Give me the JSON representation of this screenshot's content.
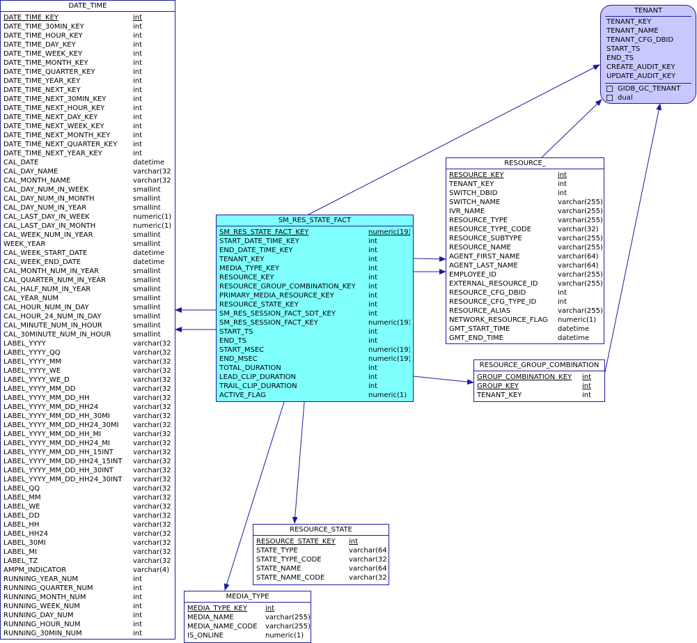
{
  "date_time": {
    "title": "DATE_TIME",
    "columns": [
      [
        "DATE_TIME_KEY",
        "int",
        true
      ],
      [
        "DATE_TIME_30MIN_KEY",
        "int"
      ],
      [
        "DATE_TIME_HOUR_KEY",
        "int"
      ],
      [
        "DATE_TIME_DAY_KEY",
        "int"
      ],
      [
        "DATE_TIME_WEEK_KEY",
        "int"
      ],
      [
        "DATE_TIME_MONTH_KEY",
        "int"
      ],
      [
        "DATE_TIME_QUARTER_KEY",
        "int"
      ],
      [
        "DATE_TIME_YEAR_KEY",
        "int"
      ],
      [
        "DATE_TIME_NEXT_KEY",
        "int"
      ],
      [
        "DATE_TIME_NEXT_30MIN_KEY",
        "int"
      ],
      [
        "DATE_TIME_NEXT_HOUR_KEY",
        "int"
      ],
      [
        "DATE_TIME_NEXT_DAY_KEY",
        "int"
      ],
      [
        "DATE_TIME_NEXT_WEEK_KEY",
        "int"
      ],
      [
        "DATE_TIME_NEXT_MONTH_KEY",
        "int"
      ],
      [
        "DATE_TIME_NEXT_QUARTER_KEY",
        "int"
      ],
      [
        "DATE_TIME_NEXT_YEAR_KEY",
        "int"
      ],
      [
        "CAL_DATE",
        "datetime"
      ],
      [
        "CAL_DAY_NAME",
        "varchar(32)"
      ],
      [
        "CAL_MONTH_NAME",
        "varchar(32)"
      ],
      [
        "CAL_DAY_NUM_IN_WEEK",
        "smallint"
      ],
      [
        "CAL_DAY_NUM_IN_MONTH",
        "smallint"
      ],
      [
        "CAL_DAY_NUM_IN_YEAR",
        "smallint"
      ],
      [
        "CAL_LAST_DAY_IN_WEEK",
        "numeric(1)"
      ],
      [
        "CAL_LAST_DAY_IN_MONTH",
        "numeric(1)"
      ],
      [
        "CAL_WEEK_NUM_IN_YEAR",
        "smallint"
      ],
      [
        "WEEK_YEAR",
        "smallint"
      ],
      [
        "CAL_WEEK_START_DATE",
        "datetime"
      ],
      [
        "CAL_WEEK_END_DATE",
        "datetime"
      ],
      [
        "CAL_MONTH_NUM_IN_YEAR",
        "smallint"
      ],
      [
        "CAL_QUARTER_NUM_IN_YEAR",
        "smallint"
      ],
      [
        "CAL_HALF_NUM_IN_YEAR",
        "smallint"
      ],
      [
        "CAL_YEAR_NUM",
        "smallint"
      ],
      [
        "CAL_HOUR_NUM_IN_DAY",
        "smallint"
      ],
      [
        "CAL_HOUR_24_NUM_IN_DAY",
        "smallint"
      ],
      [
        "CAL_MINUTE_NUM_IN_HOUR",
        "smallint"
      ],
      [
        "CAL_30MINUTE_NUM_IN_HOUR",
        "smallint"
      ],
      [
        "LABEL_YYYY",
        "varchar(32)"
      ],
      [
        "LABEL_YYYY_QQ",
        "varchar(32)"
      ],
      [
        "LABEL_YYYY_MM",
        "varchar(32)"
      ],
      [
        "LABEL_YYYY_WE",
        "varchar(32)"
      ],
      [
        "LABEL_YYYY_WE_D",
        "varchar(32)"
      ],
      [
        "LABEL_YYYY_MM_DD",
        "varchar(32)"
      ],
      [
        "LABEL_YYYY_MM_DD_HH",
        "varchar(32)"
      ],
      [
        "LABEL_YYYY_MM_DD_HH24",
        "varchar(32)"
      ],
      [
        "LABEL_YYYY_MM_DD_HH_30MI",
        "varchar(32)"
      ],
      [
        "LABEL_YYYY_MM_DD_HH24_30MI",
        "varchar(32)"
      ],
      [
        "LABEL_YYYY_MM_DD_HH_MI",
        "varchar(32)"
      ],
      [
        "LABEL_YYYY_MM_DD_HH24_MI",
        "varchar(32)"
      ],
      [
        "LABEL_YYYY_MM_DD_HH_15INT",
        "varchar(32)"
      ],
      [
        "LABEL_YYYY_MM_DD_HH24_15INT",
        "varchar(32)"
      ],
      [
        "LABEL_YYYY_MM_DD_HH_30INT",
        "varchar(32)"
      ],
      [
        "LABEL_YYYY_MM_DD_HH24_30INT",
        "varchar(32)"
      ],
      [
        "LABEL_QQ",
        "varchar(32)"
      ],
      [
        "LABEL_MM",
        "varchar(32)"
      ],
      [
        "LABEL_WE",
        "varchar(32)"
      ],
      [
        "LABEL_DD",
        "varchar(32)"
      ],
      [
        "LABEL_HH",
        "varchar(32)"
      ],
      [
        "LABEL_HH24",
        "varchar(32)"
      ],
      [
        "LABEL_30MI",
        "varchar(32)"
      ],
      [
        "LABEL_MI",
        "varchar(32)"
      ],
      [
        "LABEL_TZ",
        "varchar(32)"
      ],
      [
        "AMPM_INDICATOR",
        "varchar(4)"
      ],
      [
        "RUNNING_YEAR_NUM",
        "int"
      ],
      [
        "RUNNING_QUARTER_NUM",
        "int"
      ],
      [
        "RUNNING_MONTH_NUM",
        "int"
      ],
      [
        "RUNNING_WEEK_NUM",
        "int"
      ],
      [
        "RUNNING_DAY_NUM",
        "int"
      ],
      [
        "RUNNING_HOUR_NUM",
        "int"
      ],
      [
        "RUNNING_30MIN_NUM",
        "int"
      ]
    ]
  },
  "sm_res_state_fact": {
    "title": "SM_RES_STATE_FACT",
    "columns": [
      [
        "SM_RES_STATE_FACT_KEY",
        "numeric(19)",
        true
      ],
      [
        "START_DATE_TIME_KEY",
        "int"
      ],
      [
        "END_DATE_TIME_KEY",
        "int"
      ],
      [
        "TENANT_KEY",
        "int"
      ],
      [
        "MEDIA_TYPE_KEY",
        "int"
      ],
      [
        "RESOURCE_KEY",
        "int"
      ],
      [
        "RESOURCE_GROUP_COMBINATION_KEY",
        "int"
      ],
      [
        "PRIMARY_MEDIA_RESOURCE_KEY",
        "int"
      ],
      [
        "RESOURCE_STATE_KEY",
        "int"
      ],
      [
        "SM_RES_SESSION_FACT_SDT_KEY",
        "int"
      ],
      [
        "SM_RES_SESSION_FACT_KEY",
        "numeric(19)"
      ],
      [
        "START_TS",
        "int"
      ],
      [
        "END_TS",
        "int"
      ],
      [
        "START_MSEC",
        "numeric(19)"
      ],
      [
        "END_MSEC",
        "numeric(19)"
      ],
      [
        "TOTAL_DURATION",
        "int"
      ],
      [
        "LEAD_CLIP_DURATION",
        "int"
      ],
      [
        "TRAIL_CLIP_DURATION",
        "int"
      ],
      [
        "ACTIVE_FLAG",
        "numeric(1)"
      ]
    ]
  },
  "resource": {
    "title": "RESOURCE_",
    "columns": [
      [
        "RESOURCE_KEY",
        "int",
        true
      ],
      [
        "TENANT_KEY",
        "int"
      ],
      [
        "SWITCH_DBID",
        "int"
      ],
      [
        "SWITCH_NAME",
        "varchar(255)"
      ],
      [
        "IVR_NAME",
        "varchar(255)"
      ],
      [
        "RESOURCE_TYPE",
        "varchar(255)"
      ],
      [
        "RESOURCE_TYPE_CODE",
        "varchar(32)"
      ],
      [
        "RESOURCE_SUBTYPE",
        "varchar(255)"
      ],
      [
        "RESOURCE_NAME",
        "varchar(255)"
      ],
      [
        "AGENT_FIRST_NAME",
        "varchar(64)"
      ],
      [
        "AGENT_LAST_NAME",
        "varchar(64)"
      ],
      [
        "EMPLOYEE_ID",
        "varchar(255)"
      ],
      [
        "EXTERNAL_RESOURCE_ID",
        "varchar(255)"
      ],
      [
        "RESOURCE_CFG_DBID",
        "int"
      ],
      [
        "RESOURCE_CFG_TYPE_ID",
        "int"
      ],
      [
        "RESOURCE_ALIAS",
        "varchar(255)"
      ],
      [
        "NETWORK_RESOURCE_FLAG",
        "numeric(1)"
      ],
      [
        "GMT_START_TIME",
        "datetime"
      ],
      [
        "GMT_END_TIME",
        "datetime"
      ]
    ]
  },
  "tenant": {
    "title": "TENANT",
    "columns": [
      [
        "TENANT_KEY",
        ""
      ],
      [
        "TENANT_NAME",
        ""
      ],
      [
        "TENANT_CFG_DBID",
        ""
      ],
      [
        "START_TS",
        ""
      ],
      [
        "END_TS",
        ""
      ],
      [
        "CREATE_AUDIT_KEY",
        ""
      ],
      [
        "UPDATE_AUDIT_KEY",
        ""
      ]
    ],
    "indexes": [
      "GIDB_GC_TENANT",
      "dual"
    ]
  },
  "resource_group_combination": {
    "title": "RESOURCE_GROUP_COMBINATION",
    "columns": [
      [
        "GROUP_COMBINATION_KEY",
        "int",
        true
      ],
      [
        "GROUP_KEY",
        "int",
        true
      ],
      [
        "TENANT_KEY",
        "int"
      ]
    ]
  },
  "resource_state": {
    "title": "RESOURCE_STATE",
    "columns": [
      [
        "RESOURCE_STATE_KEY",
        "int",
        true
      ],
      [
        "STATE_TYPE",
        "varchar(64)"
      ],
      [
        "STATE_TYPE_CODE",
        "varchar(32)"
      ],
      [
        "STATE_NAME",
        "varchar(64)"
      ],
      [
        "STATE_NAME_CODE",
        "varchar(32)"
      ]
    ]
  },
  "media_type": {
    "title": "MEDIA_TYPE",
    "columns": [
      [
        "MEDIA_TYPE_KEY",
        "int",
        true
      ],
      [
        "MEDIA_NAME",
        "varchar(255)"
      ],
      [
        "MEDIA_NAME_CODE",
        "varchar(255)"
      ],
      [
        "IS_ONLINE",
        "numeric(1)"
      ]
    ]
  },
  "colors": {
    "line": "#1a1aa0",
    "fact_fill": "#80ffff",
    "tenant_fill": "#c8c8ff"
  }
}
